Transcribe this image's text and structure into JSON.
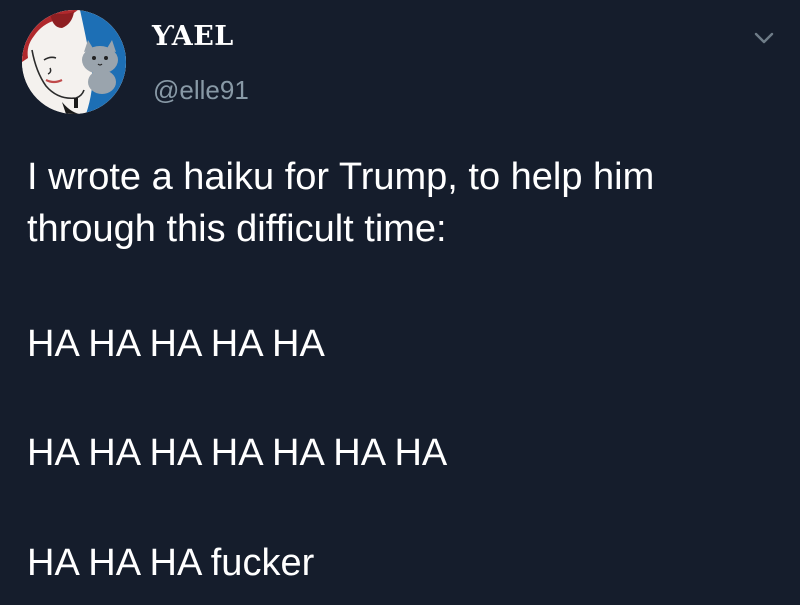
{
  "user": {
    "display_name": "ƳAEL",
    "handle": "@elle91"
  },
  "tweet": {
    "lines": [
      "I wrote a haiku for Trump, to help him",
      "through this difficult time:"
    ],
    "haiku": [
      "HA HA HA HA HA",
      "HA HA HA HA HA HA HA",
      "HA HA HA fucker"
    ]
  },
  "icons": {
    "menu": "chevron-down-icon",
    "avatar": "profile-avatar"
  },
  "colors": {
    "background": "#151d2c",
    "text": "#ffffff",
    "secondary_text": "#8899a6",
    "avatar_hair": "#b0292d",
    "avatar_blue": "#1d6fb5"
  }
}
